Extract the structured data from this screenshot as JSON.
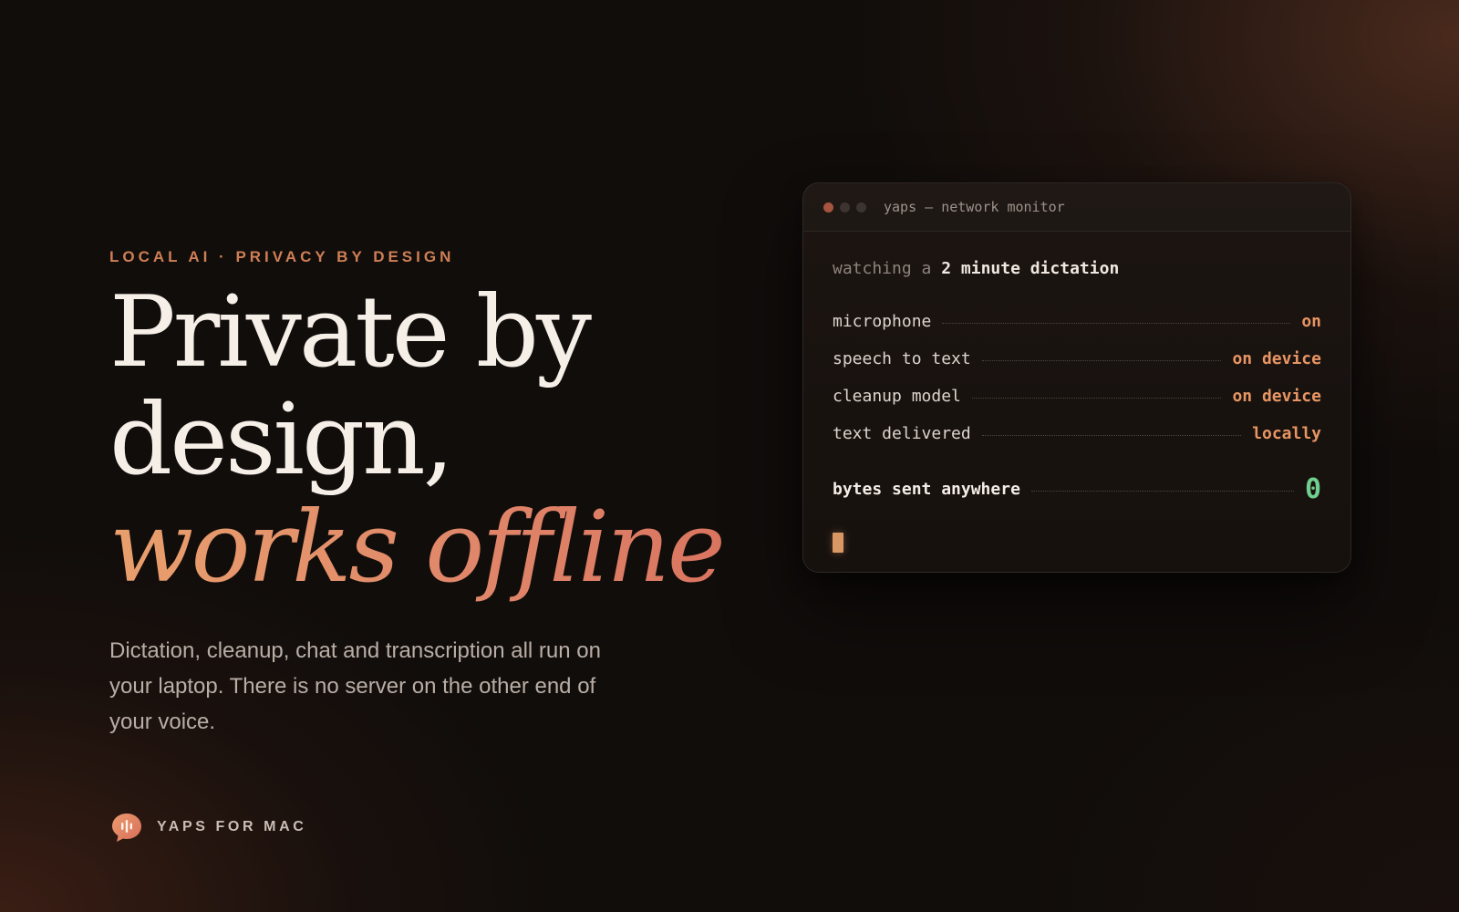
{
  "hero": {
    "eyebrow": "LOCAL AI · PRIVACY BY DESIGN",
    "headline_line1": "Private by",
    "headline_line2": "design,",
    "headline_accent": "works offline",
    "lede": "Dictation, cleanup, chat and transcription all run on your laptop. There is no server on the other end of your voice."
  },
  "brand": {
    "label": "YAPS FOR MAC",
    "icon": "speech-bubble-waveform-icon"
  },
  "terminal": {
    "title": "yaps — network monitor",
    "watching_prefix": "watching a",
    "watching_strong": "2 minute dictation",
    "rows": [
      {
        "label": "microphone",
        "value": "on"
      },
      {
        "label": "speech to text",
        "value": "on device"
      },
      {
        "label": "cleanup model",
        "value": "on device"
      },
      {
        "label": "text delivered",
        "value": "locally"
      }
    ],
    "total": {
      "label": "bytes sent anywhere",
      "value": "0"
    }
  },
  "colors": {
    "background": "#110d0b",
    "accent": "#e89563",
    "accent_gradient_start": "#e9a06c",
    "accent_gradient_end": "#d9735f",
    "success": "#6fcf8e",
    "traffic_red": "#a5543d",
    "traffic_grey": "#3b3431"
  }
}
